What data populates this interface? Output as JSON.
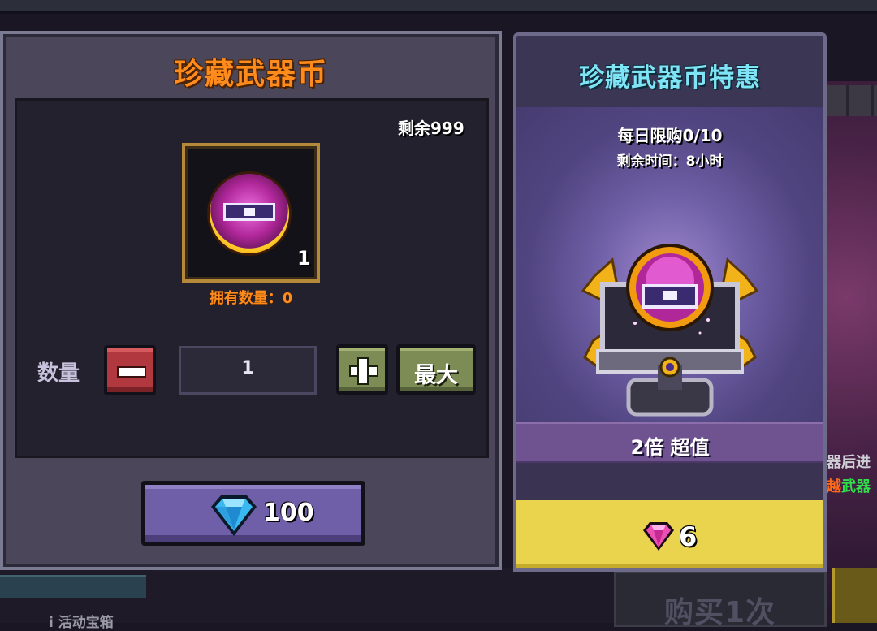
{
  "background": {
    "side_text_line1": "器后进",
    "side_text_line2_part1": "越",
    "side_text_line2_part2": "武器",
    "bottom_left_text": "ⅰ 活动宝箱",
    "buy_button_label": "购买1次"
  },
  "purchase_dialog": {
    "title": "珍藏武器币",
    "stock_label": "剩余999",
    "item": {
      "icon": "collector-weapon-coin-icon",
      "count": "1"
    },
    "owned_label": "拥有数量：0",
    "quantity": {
      "label": "数量",
      "value": "1",
      "max_label": "最大"
    },
    "price": {
      "currency_icon": "blue-gem-icon",
      "amount": "100"
    }
  },
  "offer_dialog": {
    "title": "珍藏武器币特惠",
    "daily_limit": "每日限购0/10",
    "time_left": "剩余时间：8小时",
    "ribbon": "2倍 超值",
    "price": {
      "currency_icon": "pink-gem-icon",
      "amount": "6"
    }
  },
  "colors": {
    "title_orange": "#ff8b1c",
    "title_cyan": "#7ee4f6",
    "minus_red": "#b0383e",
    "plus_green": "#7c8c54",
    "price_purple": "#6f5ea8",
    "buy_yellow": "#ead44e"
  }
}
